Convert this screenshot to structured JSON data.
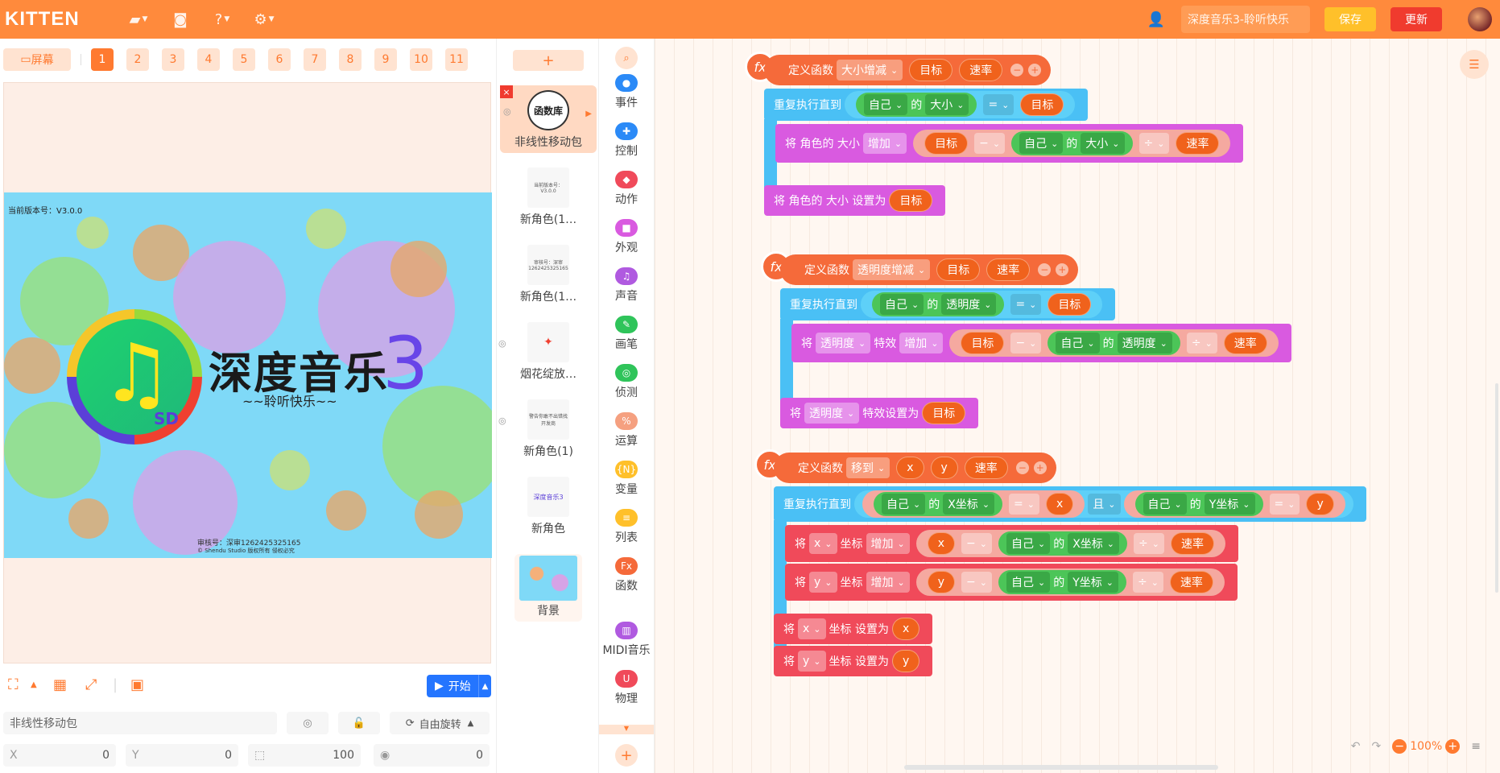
{
  "topbar": {
    "logo": "KITTEN",
    "project_name": "深度音乐3-聆听快乐",
    "save_label": "保存",
    "update_label": "更新"
  },
  "scenes": {
    "screen_label": "屏幕",
    "pages": [
      "1",
      "2",
      "3",
      "4",
      "5",
      "6",
      "7",
      "8",
      "9",
      "10",
      "11"
    ],
    "active_page": "1"
  },
  "stage": {
    "version_text": "当前版本号：V3.0.0",
    "title": "深度音乐",
    "title_num": "3",
    "subtitle": "~~聆听快乐~~",
    "logo_sd": "SD",
    "audit_line1": "审核号：深审1262425325165",
    "audit_line2": "© Shendu Studio 版权所有 侵权必究"
  },
  "controls": {
    "start_label": "开始"
  },
  "props": {
    "sprite_name": "非线性移动包",
    "rotate_label": "自由旋转",
    "x_label": "X",
    "x_value": "0",
    "y_label": "Y",
    "y_value": "0",
    "scale_value": "100",
    "dir_value": "0"
  },
  "sprites": [
    {
      "name": "非线性移动包",
      "thumb": "函数库"
    },
    {
      "name": "新角色(1…",
      "thumb": "当前版本号：V3.0.0"
    },
    {
      "name": "新角色(1…",
      "thumb": "审核号：深审1262425325165"
    },
    {
      "name": "烟花绽放…",
      "thumb": "✦"
    },
    {
      "name": "新角色(1)",
      "thumb": "警告你敢不出错找开发商"
    },
    {
      "name": "新角色",
      "thumb": "深度音乐3"
    },
    {
      "name": "背景",
      "thumb": ""
    }
  ],
  "categories": [
    {
      "label": "事件",
      "color": "#2b8af7",
      "icon": "●"
    },
    {
      "label": "控制",
      "color": "#2b8af7",
      "icon": "✚"
    },
    {
      "label": "动作",
      "color": "#f04a5a",
      "icon": "◆"
    },
    {
      "label": "外观",
      "color": "#d95ae0",
      "icon": "■"
    },
    {
      "label": "声音",
      "color": "#b05ae0",
      "icon": "♫"
    },
    {
      "label": "画笔",
      "color": "#2fc45a",
      "icon": "✎"
    },
    {
      "label": "侦测",
      "color": "#2fc45a",
      "icon": "◎"
    },
    {
      "label": "运算",
      "color": "#f5a080",
      "icon": "%"
    },
    {
      "label": "变量",
      "color": "#ffc02a",
      "icon": "{N}"
    },
    {
      "label": "列表",
      "color": "#ffc02a",
      "icon": "≡"
    },
    {
      "label": "函数",
      "color": "#f56a3a",
      "icon": "Fx"
    },
    {
      "label": "MIDI音乐",
      "color": "#b05ae0",
      "icon": "▥"
    },
    {
      "label": "物理",
      "color": "#f04a5a",
      "icon": "U"
    }
  ],
  "blocks": {
    "fx": "fx",
    "define": "定义函数",
    "repeat_until": "重复执行直到",
    "self": "自己",
    "of": "的",
    "eq": "=",
    "minus": "−",
    "div": "÷",
    "and": "且",
    "set_word": "将",
    "f1": {
      "name": "大小增减",
      "p1": "目标",
      "p2": "速率",
      "prop": "大小",
      "line2": "将 角色的 大小",
      "inc": "增加",
      "line3": "将 角色的 大小 设置为"
    },
    "f2": {
      "name": "透明度增减",
      "p1": "目标",
      "p2": "速率",
      "prop": "透明度",
      "effect": "特效",
      "inc": "增加",
      "set_to": "特效设置为"
    },
    "f3": {
      "name": "移到",
      "p1": "x",
      "p2": "y",
      "p3": "速率",
      "xprop": "X坐标",
      "yprop": "Y坐标",
      "coord": "坐标",
      "inc": "增加",
      "set_to": "坐标 设置为"
    }
  },
  "workspace": {
    "zoom": "100%"
  }
}
